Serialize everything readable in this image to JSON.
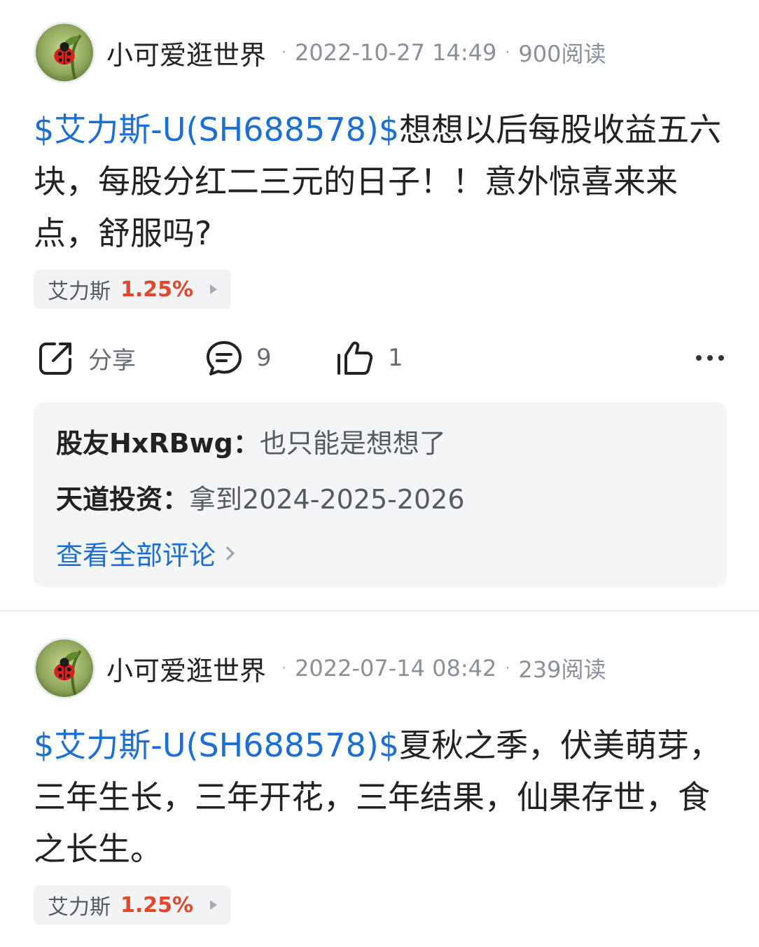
{
  "posts": [
    {
      "author": "小可爱逛世界",
      "date": "2022-10-27 14:49",
      "reads": "900阅读",
      "stock_link": "$艾力斯-U(SH688578)$",
      "text": "想想以后每股收益五六块，每股分红二三元的日子！！意外惊喜来来点，舒服吗?",
      "tag": {
        "name": "艾力斯",
        "change": "1.25%"
      },
      "actions": {
        "share_label": "分享",
        "comment_count": "9",
        "like_count": "1"
      },
      "comments": [
        {
          "user": "股友HxRBwg",
          "text": "也只能是想想了"
        },
        {
          "user": "天道投资",
          "text": "拿到2024-2025-2026"
        }
      ],
      "view_all_comments": "查看全部评论"
    },
    {
      "author": "小可爱逛世界",
      "date": "2022-07-14 08:42",
      "reads": "239阅读",
      "stock_link": "$艾力斯-U(SH688578)$",
      "text": "夏秋之季，伏美萌芽，三年生长，三年开花，三年结果，仙果存世，食之长生。",
      "tag": {
        "name": "艾力斯",
        "change": "1.25%"
      }
    }
  ],
  "separator": "·",
  "colon": "：",
  "icons": {
    "avatar": "ladybug-avatar-icon",
    "share": "share-icon",
    "comment": "comment-icon",
    "like": "thumbs-up-icon",
    "more": "more-icon",
    "tag_arrow": "triangle-right-icon",
    "view_all_arrow": "chevron-right-icon"
  },
  "colors": {
    "link": "#1b6fd3",
    "gain": "#e1472d",
    "meta": "#8a8f99",
    "comment_bg": "#f4f5f7"
  }
}
